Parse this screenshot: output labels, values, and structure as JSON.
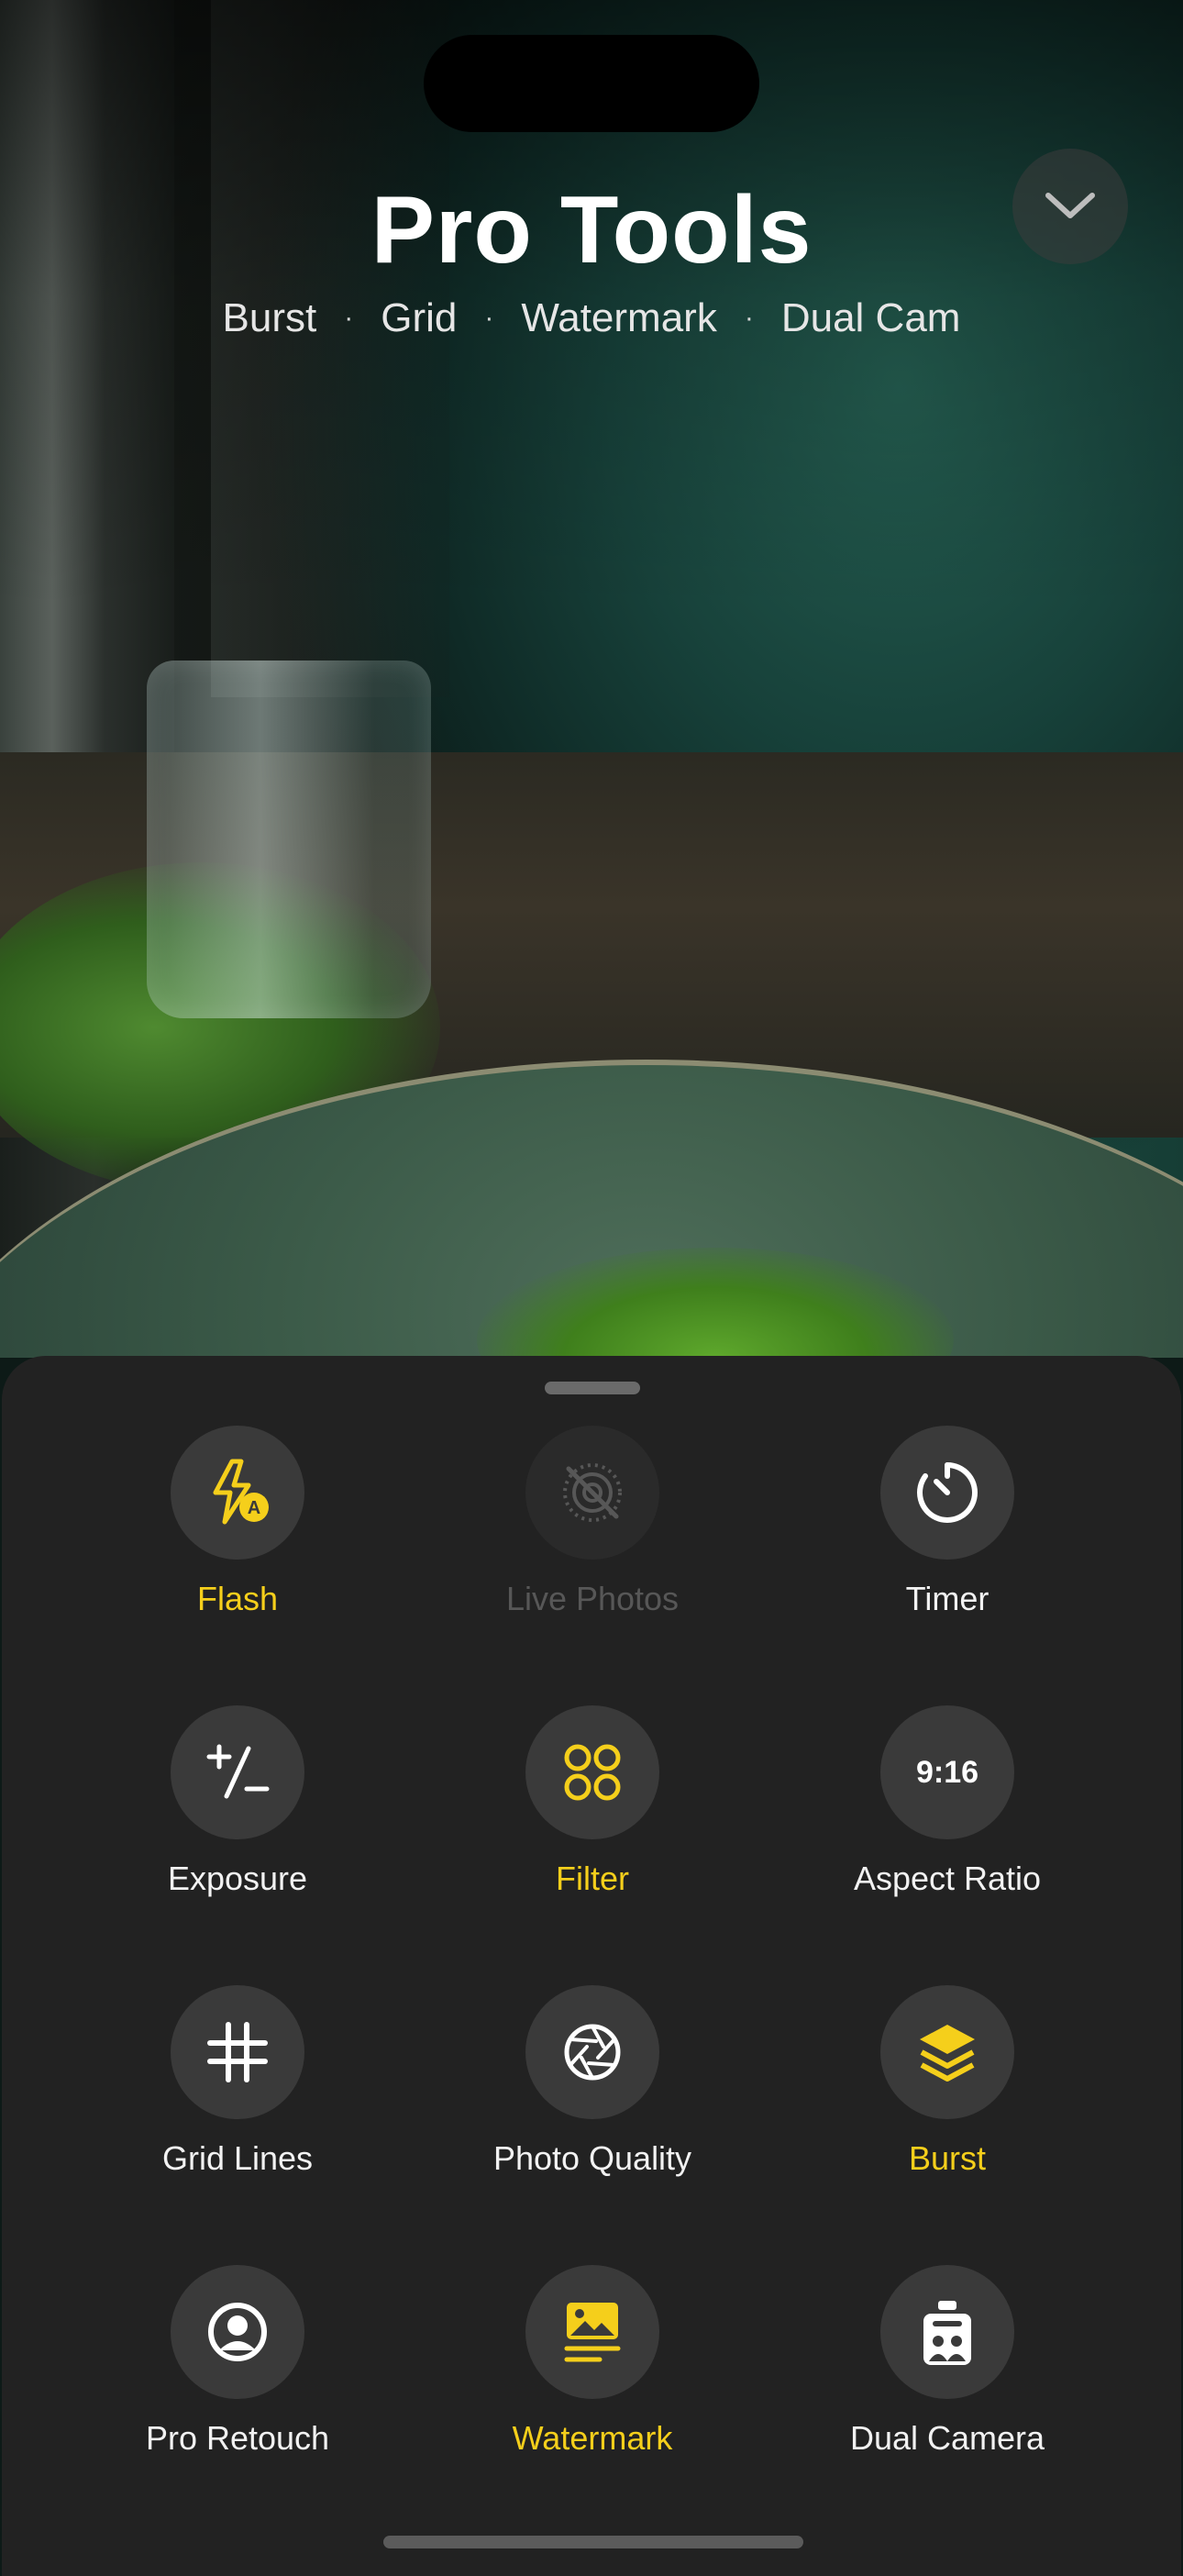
{
  "header": {
    "title": "Pro Tools",
    "subtitle_items": [
      "Burst",
      "Grid",
      "Watermark",
      "Dual Cam"
    ],
    "separator": "·"
  },
  "collapse_button": {
    "icon": "chevron-down-icon"
  },
  "colors": {
    "accent": "#F5CF1B",
    "sheet": "#222222",
    "tile": "#3A3A3A",
    "disabled": "#575757",
    "text": "#F2F2F2"
  },
  "tools": [
    {
      "label": "Flash",
      "icon": "flash-auto-icon",
      "state": "active"
    },
    {
      "label": "Live Photos",
      "icon": "live-photos-off-icon",
      "state": "disabled"
    },
    {
      "label": "Timer",
      "icon": "timer-icon",
      "state": "normal"
    },
    {
      "label": "Exposure",
      "icon": "exposure-icon",
      "state": "normal"
    },
    {
      "label": "Filter",
      "icon": "filter-icon",
      "state": "active"
    },
    {
      "label": "Aspect Ratio",
      "icon": "aspect-ratio-icon",
      "value": "9:16",
      "state": "normal"
    },
    {
      "label": "Grid Lines",
      "icon": "grid-lines-icon",
      "state": "normal"
    },
    {
      "label": "Photo Quality",
      "icon": "aperture-icon",
      "state": "normal"
    },
    {
      "label": "Burst",
      "icon": "burst-layers-icon",
      "state": "active"
    },
    {
      "label": "Pro Retouch",
      "icon": "portrait-icon",
      "state": "normal"
    },
    {
      "label": "Watermark",
      "icon": "watermark-icon",
      "state": "active"
    },
    {
      "label": "Dual Camera",
      "icon": "dual-camera-icon",
      "state": "normal"
    }
  ]
}
